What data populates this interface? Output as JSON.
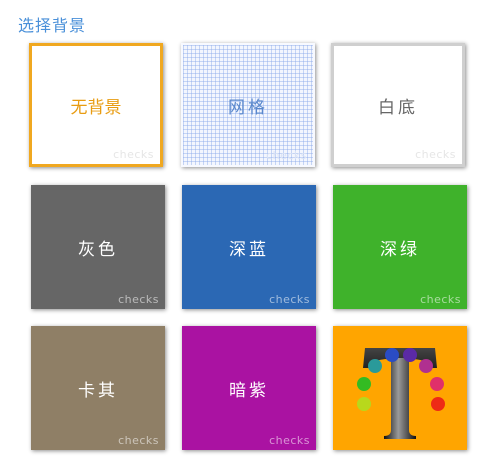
{
  "header": {
    "title": "选择背景"
  },
  "tiles": [
    {
      "label": "无背景",
      "checks": "checks",
      "color": "#ffffff"
    },
    {
      "label": "网格",
      "checks": "checks",
      "color": "#f3f6fe"
    },
    {
      "label": "白底",
      "checks": "checks",
      "color": "#ffffff"
    },
    {
      "label": "灰色",
      "checks": "checks",
      "color": "#666666"
    },
    {
      "label": "深蓝",
      "checks": "checks",
      "color": "#2b68b4"
    },
    {
      "label": "深绿",
      "checks": "checks",
      "color": "#3fb22b"
    },
    {
      "label": "卡其",
      "checks": "checks",
      "color": "#8f7f66"
    },
    {
      "label": "暗紫",
      "checks": "checks",
      "color": "#aa12a2"
    },
    {
      "label": "",
      "checks": "",
      "color": "#ffa500",
      "icon": "logo-t-icon"
    }
  ],
  "colors": {
    "selected_border": "#f0a820",
    "title": "#4a90d9"
  }
}
